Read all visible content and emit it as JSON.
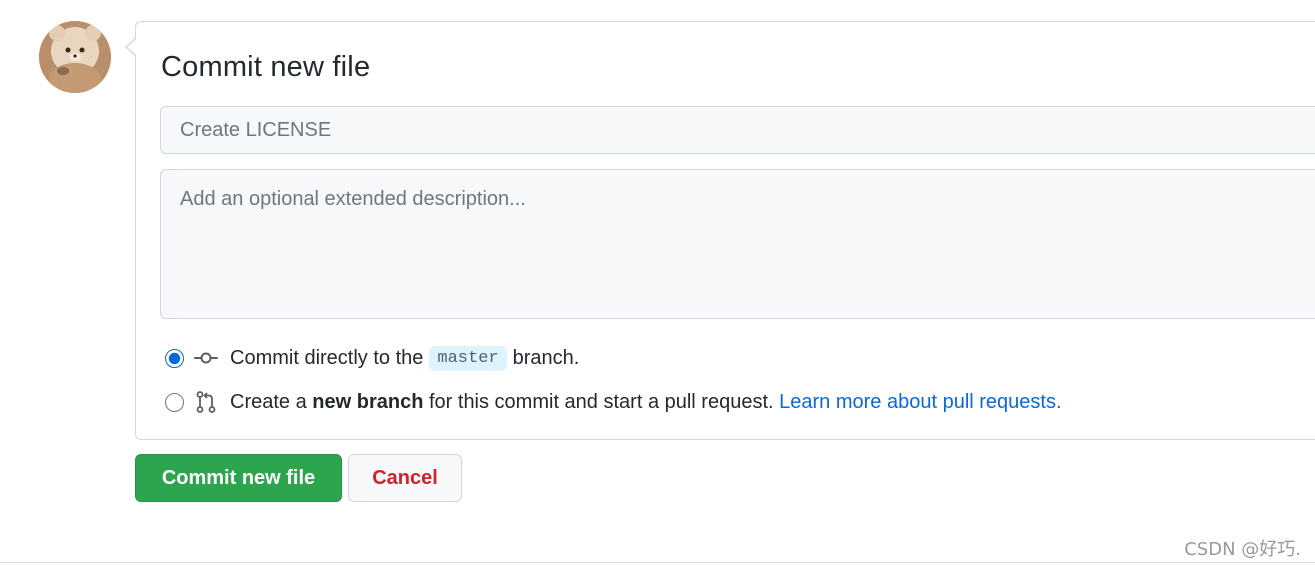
{
  "form": {
    "title": "Commit new file",
    "summary_placeholder": "Create LICENSE",
    "description_placeholder": "Add an optional extended description..."
  },
  "options": {
    "direct": {
      "selected": true,
      "text_before": "Commit directly to the",
      "branch": "master",
      "text_after": "branch."
    },
    "new_branch": {
      "selected": false,
      "text_before": "Create a",
      "bold": "new branch",
      "text_after": "for this commit and start a pull request.",
      "link": "Learn more about pull requests."
    }
  },
  "buttons": {
    "commit": "Commit new file",
    "cancel": "Cancel"
  },
  "watermark": "CSDN @好巧.",
  "icons": {
    "direct": "git-commit-icon",
    "new_branch": "git-pull-request-icon"
  },
  "colors": {
    "primary_button": "#2da44e",
    "danger_text": "#cf222e",
    "link": "#0969da",
    "branch_tag_bg": "#ddf4ff"
  }
}
